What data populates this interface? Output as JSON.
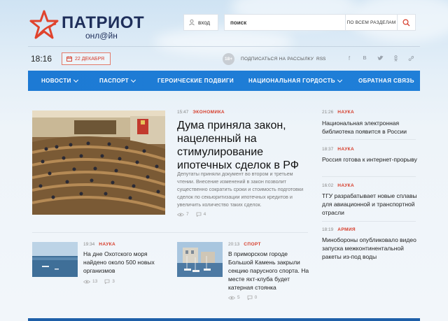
{
  "header": {
    "logo_title": "ПАТРИОТ",
    "logo_sub": "онл@йн",
    "login_label": "вход",
    "search_placeholder": "поиск",
    "search_scope": "ПО ВСЕМ РАЗДЕЛАМ"
  },
  "topbar": {
    "time": "18:16",
    "date": "22 ДЕКАБРЯ",
    "age_rating": "18+",
    "subscribe": "ПОДПИСАТЬСЯ НА РАССЫЛКУ",
    "rss": "RSS",
    "socials": [
      "facebook-icon",
      "vk-icon",
      "twitter-icon",
      "odnoklassniki-icon",
      "link-icon"
    ]
  },
  "nav": {
    "items": [
      {
        "label": "НОВОСТИ",
        "dropdown": true
      },
      {
        "label": "ПАСПОРТ",
        "dropdown": true
      },
      {
        "label": "ГЕРОИЧЕСКИЕ ПОДВИГИ",
        "dropdown": false
      },
      {
        "label": "НАЦИОНАЛЬНАЯ ГОРДОСТЬ",
        "dropdown": true
      },
      {
        "label": "ОБРАТНАЯ СВЯЗЬ",
        "dropdown": false
      }
    ]
  },
  "lead": {
    "time": "15:47",
    "category": "ЭКОНОМИКА",
    "title": "Дума приняла закон, нацеленный на стимулирование ипотечных сделок в РФ",
    "description": "Депутаты приняли документ во втором и третьем чтении. Внесение изменений в закон позволит существенно сократить сроки и стоимость подготовки сделок по секьюритизации ипотечных кредитов и увеличить количество таких сделок.",
    "views": "7",
    "comments": "4"
  },
  "side": [
    {
      "time": "21:26",
      "category": "НАУКА",
      "title": "Национальная электронная библиотека появится в России"
    },
    {
      "time": "18:37",
      "category": "НАУКА",
      "title": "Россия готова к интернет-прорыву"
    },
    {
      "time": "16:02",
      "category": "НАУКА",
      "title": "ТГУ разрабатывает новые сплавы для авиационной и транспортной отрасли"
    },
    {
      "time": "18:19",
      "category": "АРМИЯ",
      "title": "Минобороны опубликовало видео запуска межконтинентальной ракеты из-под воды"
    }
  ],
  "small": [
    {
      "time": "19:34",
      "category": "НАУКА",
      "title": "На дне Охотского моря найдено около 500 новых организмов",
      "views": "13",
      "comments": "3"
    },
    {
      "time": "20:13",
      "category": "СПОРТ",
      "title": "В приморском городе Большой Камень закрыли секцию парусного спорта. На месте яхт-клуба будет катерная стоянка",
      "views": "5",
      "comments": "0"
    }
  ],
  "colors": {
    "accent_red": "#d63c2a",
    "nav_blue": "#1f7fd8",
    "logo_navy": "#1e2e5a"
  }
}
